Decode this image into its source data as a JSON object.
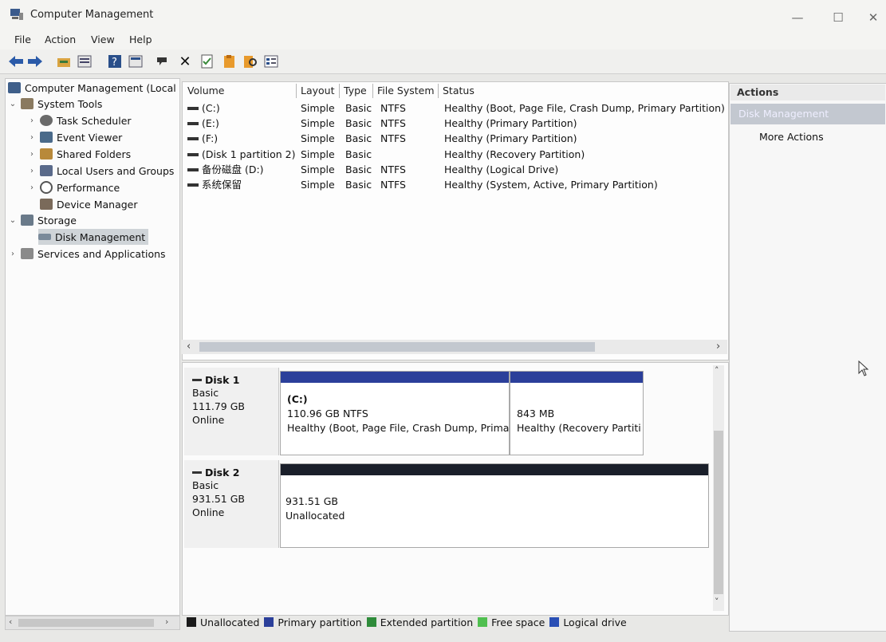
{
  "window": {
    "title": "Computer Management",
    "controls": [
      "—",
      "☐",
      "✕"
    ]
  },
  "menu": [
    "File",
    "Action",
    "View",
    "Help"
  ],
  "toolbar": [
    "back-icon",
    "forward-icon",
    "up-folder-icon",
    "properties-icon",
    "help-icon",
    "console-icon",
    "connect-icon",
    "delete-icon",
    "check-icon",
    "export-icon",
    "search-disk-icon",
    "list-icon"
  ],
  "tree": {
    "root": "Computer Management (Local",
    "system_tools": "System Tools",
    "task_scheduler": "Task Scheduler",
    "event_viewer": "Event Viewer",
    "shared_folders": "Shared Folders",
    "local_users": "Local Users and Groups",
    "performance": "Performance",
    "device_manager": "Device Manager",
    "storage": "Storage",
    "disk_management": "Disk Management",
    "services": "Services and Applications"
  },
  "volumes": {
    "headers": [
      "Volume",
      "Layout",
      "Type",
      "File System",
      "Status"
    ],
    "rows": [
      [
        "(C:)",
        "Simple",
        "Basic",
        "NTFS",
        "Healthy (Boot, Page File, Crash Dump, Primary Partition)"
      ],
      [
        "(E:)",
        "Simple",
        "Basic",
        "NTFS",
        "Healthy (Primary Partition)"
      ],
      [
        "(F:)",
        "Simple",
        "Basic",
        "NTFS",
        "Healthy (Primary Partition)"
      ],
      [
        "(Disk 1 partition 2)",
        "Simple",
        "Basic",
        "",
        "Healthy (Recovery Partition)"
      ],
      [
        "备份磁盘 (D:)",
        "Simple",
        "Basic",
        "NTFS",
        "Healthy (Logical Drive)"
      ],
      [
        "系统保留",
        "Simple",
        "Basic",
        "NTFS",
        "Healthy (System, Active, Primary Partition)"
      ]
    ]
  },
  "disks": [
    {
      "name": "Disk 1",
      "type": "Basic",
      "size": "111.79 GB",
      "state": "Online",
      "partitions": [
        {
          "title": "(C:)",
          "size": "110.96 GB NTFS",
          "status": "Healthy (Boot, Page File, Crash Dump, Prima"
        },
        {
          "title": "",
          "size": "843 MB",
          "status": "Healthy (Recovery Partiti"
        }
      ]
    },
    {
      "name": "Disk 2",
      "type": "Basic",
      "size": "931.51 GB",
      "state": "Online",
      "partitions": [
        {
          "title": "",
          "size": "931.51 GB",
          "status": "Unallocated"
        }
      ]
    }
  ],
  "legend": [
    {
      "label": "Unallocated",
      "color": "#1a1a1a"
    },
    {
      "label": "Primary partition",
      "color": "#2b3f9a"
    },
    {
      "label": "Extended partition",
      "color": "#2e8b3a"
    },
    {
      "label": "Free space",
      "color": "#4fbf4f"
    },
    {
      "label": "Logical drive",
      "color": "#2a4fb5"
    }
  ],
  "actions": {
    "title": "Actions",
    "selected": "Disk Management",
    "more": "More Actions"
  },
  "colors": {
    "primary_bar": "#2b3f9a",
    "unallocated_bar": "#1a1f2a"
  }
}
